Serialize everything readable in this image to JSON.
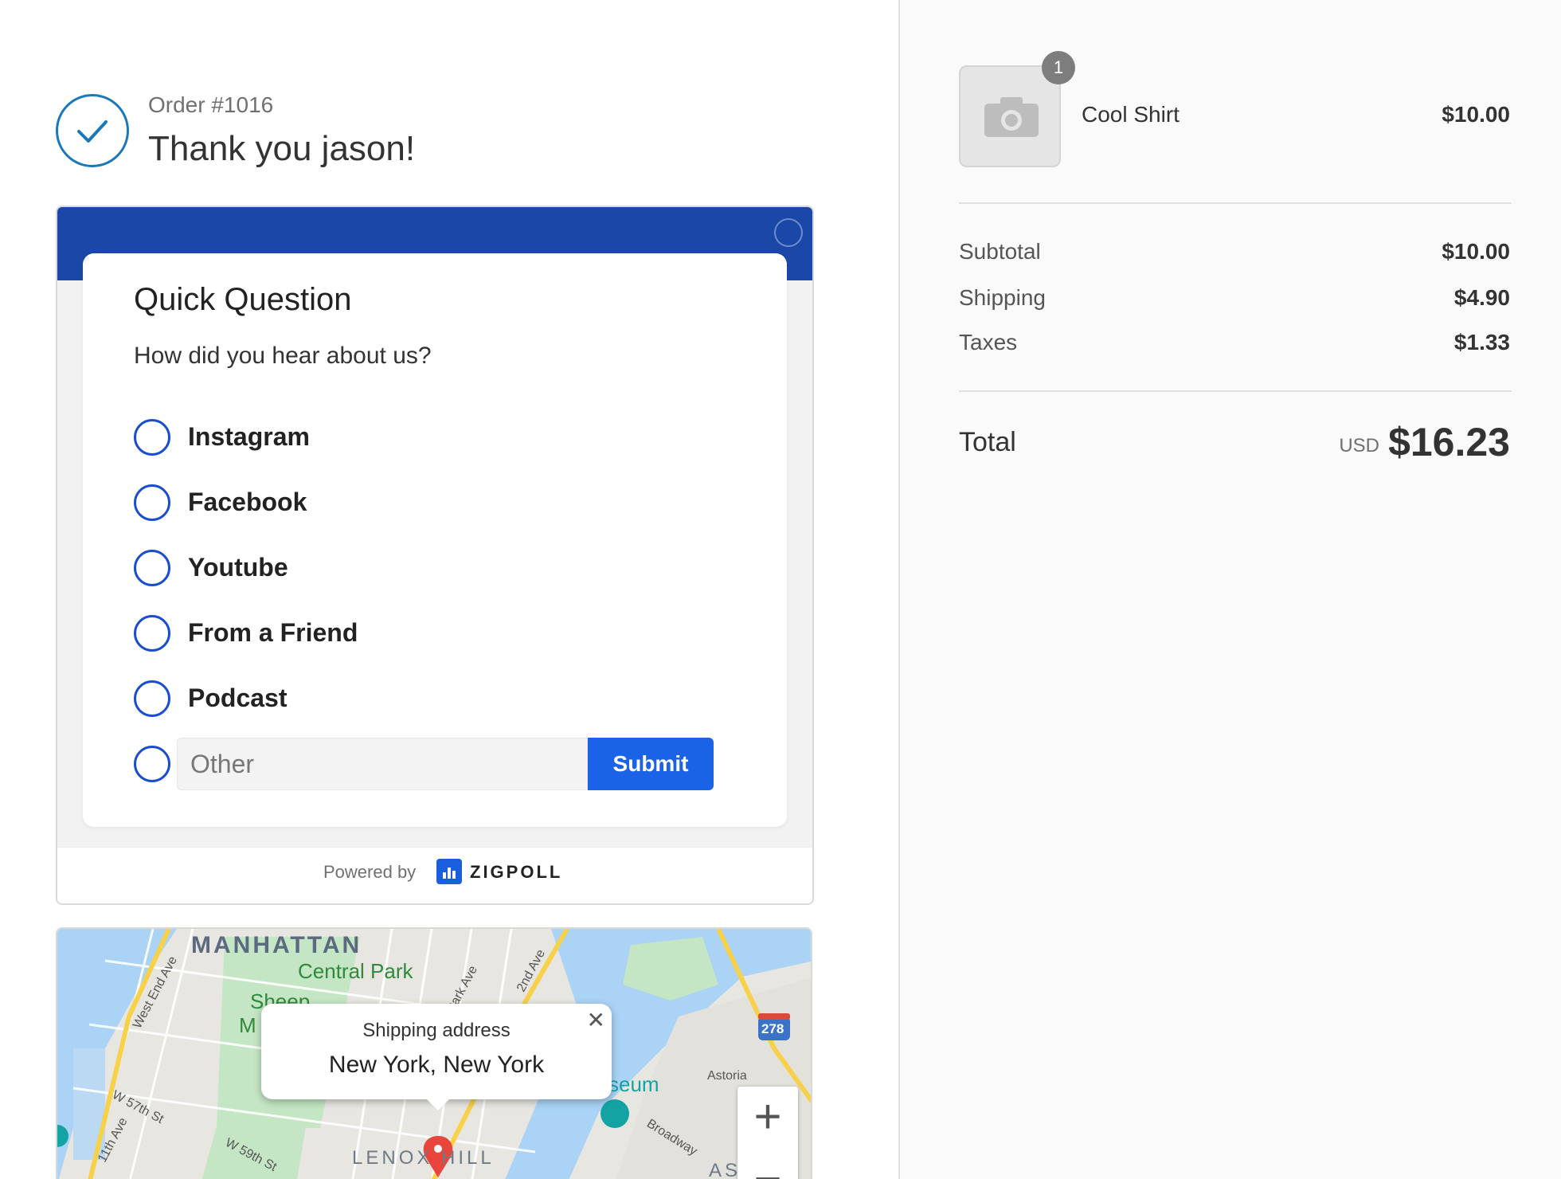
{
  "header": {
    "order_number": "Order #1016",
    "thank_you": "Thank you jason!"
  },
  "survey": {
    "title": "Quick Question",
    "question": "How did you hear about us?",
    "options": [
      "Instagram",
      "Facebook",
      "Youtube",
      "From a Friend",
      "Podcast"
    ],
    "other_placeholder": "Other",
    "other_value": "",
    "submit_label": "Submit",
    "powered_by": "Powered by",
    "brand": "ZIGPOLL",
    "brand_color": "#1b48a8",
    "button_color": "#1b63e6"
  },
  "map": {
    "popup_title": "Shipping address",
    "popup_address": "New York, New York",
    "labels": {
      "manhattan": "MANHATTAN",
      "central_park": "Central Park",
      "sheep": "Sheep",
      "meadow_partial": "M",
      "lenox_hill": "LENOX HILL",
      "museum_partial": "seum",
      "astoria": "Astoria",
      "highway": "278",
      "west_end_ave": "West End Ave",
      "w57": "W 57th St",
      "w59": "W 59th St",
      "eleventh": "11th Ave",
      "second_ave": "2nd Ave",
      "park_ave": "Park Ave",
      "broadway": "Broadway",
      "astoria_partial": "AS"
    },
    "zoom_in": "+",
    "zoom_out": "−"
  },
  "order_summary": {
    "item": {
      "name": "Cool Shirt",
      "price": "$10.00",
      "quantity": "1"
    },
    "subtotal_label": "Subtotal",
    "subtotal": "$10.00",
    "shipping_label": "Shipping",
    "shipping": "$4.90",
    "taxes_label": "Taxes",
    "taxes": "$1.33",
    "total_label": "Total",
    "currency": "USD",
    "total": "$16.23"
  }
}
